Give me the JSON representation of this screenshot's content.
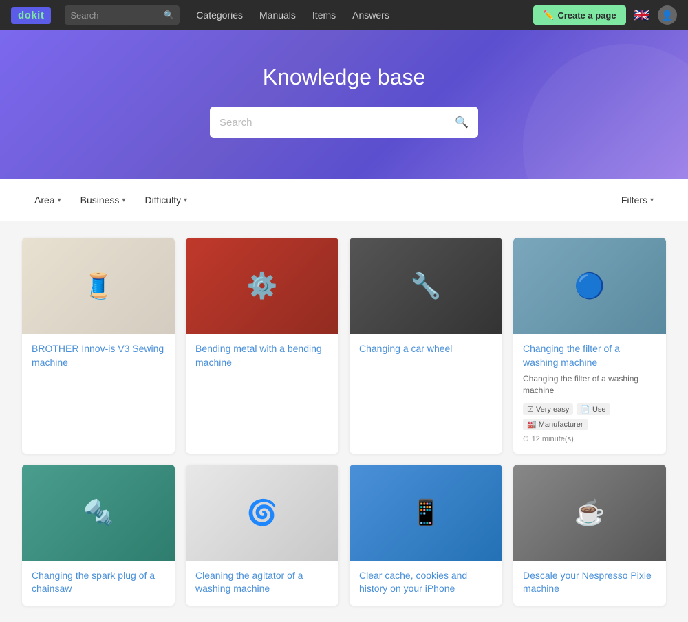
{
  "navbar": {
    "logo_text": "dok",
    "logo_accent": "it",
    "search_placeholder": "Search",
    "nav_links": [
      {
        "label": "Categories",
        "href": "#"
      },
      {
        "label": "Manuals",
        "href": "#"
      },
      {
        "label": "Items",
        "href": "#"
      },
      {
        "label": "Answers",
        "href": "#"
      }
    ],
    "create_btn": "Create a page",
    "flag": "🇬🇧"
  },
  "hero": {
    "title": "Knowledge base",
    "search_placeholder": "Search"
  },
  "filters": {
    "area_label": "Area",
    "business_label": "Business",
    "difficulty_label": "Difficulty",
    "filters_label": "Filters"
  },
  "cards": [
    {
      "id": "sewing",
      "title": "BROTHER Innov-is V3 Sewing machine",
      "desc": "",
      "img_color": "img-sewing",
      "img_emoji": "🧵",
      "tags": [],
      "time": ""
    },
    {
      "id": "bending",
      "title": "Bending metal with a bending machine",
      "desc": "",
      "img_color": "img-metal",
      "img_emoji": "⚙️",
      "tags": [],
      "time": ""
    },
    {
      "id": "wheel",
      "title": "Changing a car wheel",
      "desc": "",
      "img_color": "img-wheel",
      "img_emoji": "🔧",
      "tags": [],
      "time": ""
    },
    {
      "id": "washing-filter",
      "title": "Changing the filter of a washing machine",
      "desc": "Changing the filter of a washing machine",
      "img_color": "img-washing-top",
      "img_emoji": "🔵",
      "tags": [
        {
          "icon": "☑",
          "label": "Very easy"
        },
        {
          "icon": "📄",
          "label": "Use"
        },
        {
          "icon": "🏭",
          "label": "Manufacturer"
        }
      ],
      "time": "12 minute(s)"
    },
    {
      "id": "chainsaw",
      "title": "Changing the spark plug of a chainsaw",
      "desc": "",
      "img_color": "img-chainsaw",
      "img_emoji": "🔩",
      "tags": [],
      "time": ""
    },
    {
      "id": "agitator",
      "title": "Cleaning the agitator of a washing machine",
      "desc": "",
      "img_color": "img-agitator",
      "img_emoji": "🌀",
      "tags": [],
      "time": ""
    },
    {
      "id": "iphone",
      "title": "Clear cache, cookies and history on your iPhone",
      "desc": "",
      "img_color": "img-iphone",
      "img_emoji": "📱",
      "tags": [],
      "time": ""
    },
    {
      "id": "nespresso",
      "title": "Descale your Nespresso Pixie machine",
      "desc": "",
      "img_color": "img-nespresso",
      "img_emoji": "☕",
      "tags": [],
      "time": ""
    }
  ]
}
